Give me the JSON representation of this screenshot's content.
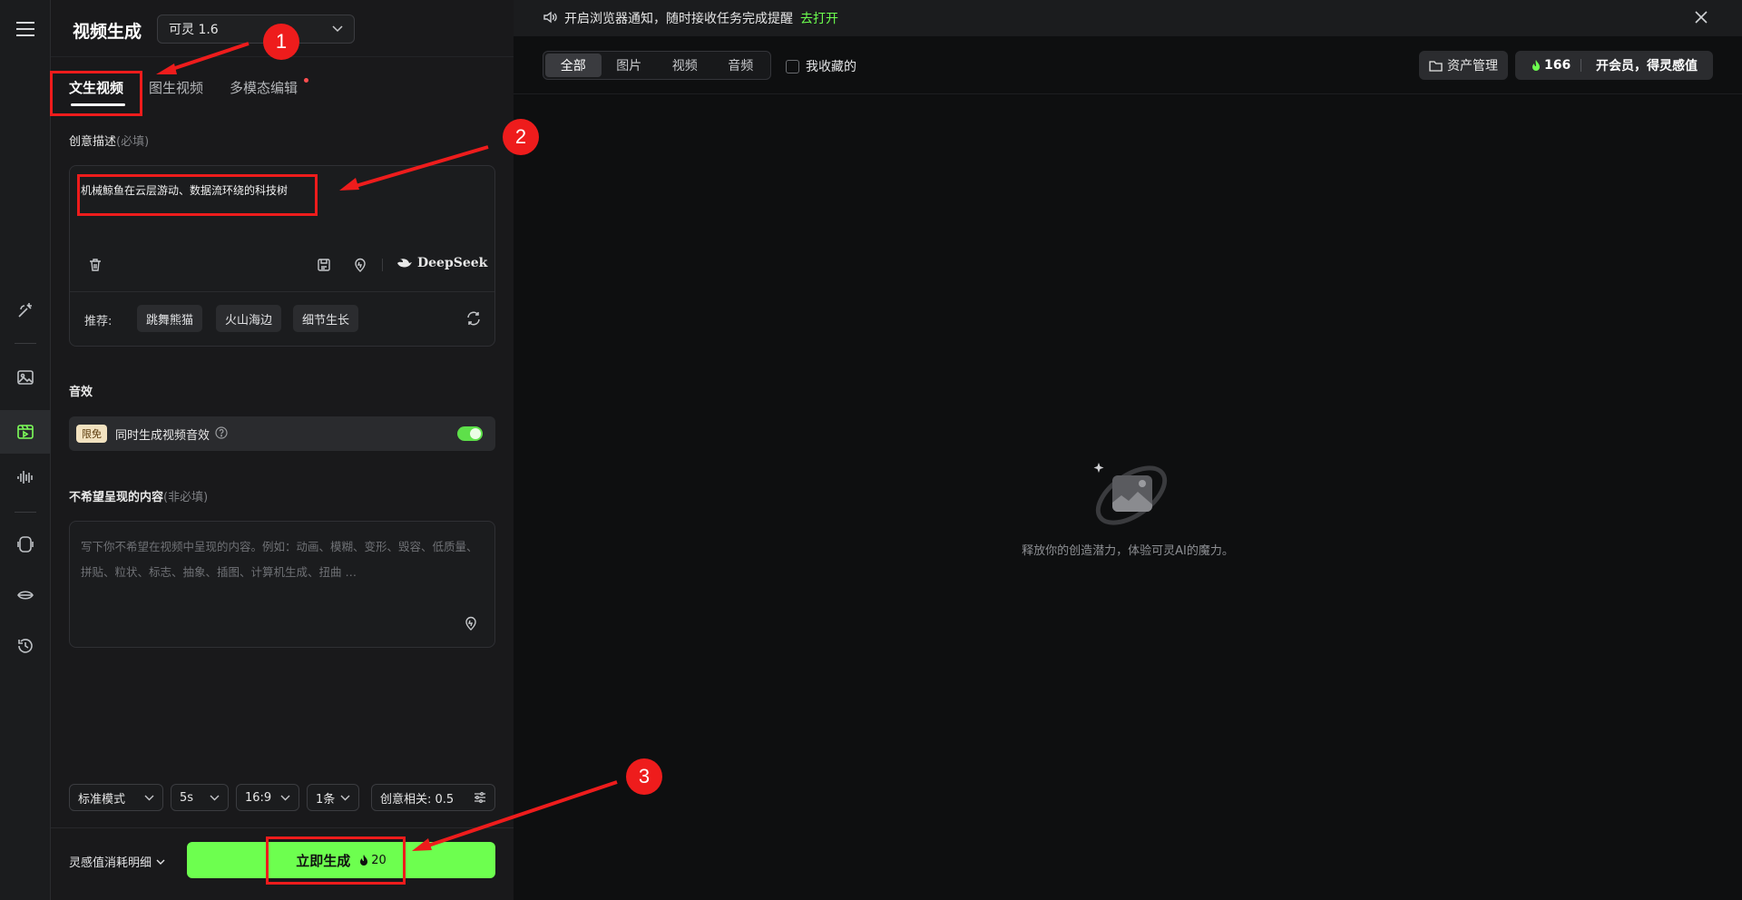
{
  "rail": {
    "icons": [
      "menu-icon",
      "magic-brush-icon",
      "image-icon",
      "video-icon",
      "audio-wave-icon",
      "avatar-icon",
      "lip-sync-icon",
      "history-icon"
    ]
  },
  "panel": {
    "title": "视频生成",
    "model": "可灵 1.6",
    "tabs": [
      {
        "label": "文生视频",
        "active": true
      },
      {
        "label": "图生视频",
        "active": false
      },
      {
        "label": "多模态编辑",
        "active": false,
        "badge_dot": true
      }
    ],
    "prompt": {
      "label": "创意描述",
      "hint": "(必填)",
      "value": "机械鲸鱼在云层游动、数据流环绕的科技树",
      "deepseek_label": "DeepSeek",
      "recommend_label": "推荐:",
      "recommend_chips": [
        "跳舞熊猫",
        "火山海边",
        "细节生长"
      ]
    },
    "sound": {
      "label": "音效",
      "badge": "限免",
      "text": "同时生成视频音效",
      "enabled": true
    },
    "negative": {
      "label": "不希望呈现的内容",
      "hint": "(非必填)",
      "placeholder": "写下你不希望在视频中呈现的内容。例如：动画、模糊、变形、毁容、低质量、拼贴、粒状、标志、抽象、插图、计算机生成、扭曲 …"
    },
    "options": {
      "mode": "标准模式",
      "duration": "5s",
      "ratio": "16:9",
      "count": "1条",
      "creativity": "创意相关: 0.5"
    },
    "cost_detail": "灵感值消耗明细",
    "generate_label": "立即生成",
    "generate_cost": "20"
  },
  "main": {
    "notice_text": "开启浏览器通知，随时接收任务完成提醒",
    "notice_link": "去打开",
    "filters": [
      {
        "label": "全部",
        "active": true
      },
      {
        "label": "图片",
        "active": false
      },
      {
        "label": "视频",
        "active": false
      },
      {
        "label": "音频",
        "active": false
      }
    ],
    "favorites_label": "我收藏的",
    "asset_label": "资产管理",
    "credits": "166",
    "vip_label": "开会员，得灵感值",
    "empty_text": "释放你的创造潜力，体验可灵AI的魔力。"
  },
  "annotations": [
    "1",
    "2",
    "3"
  ],
  "colors": {
    "accent": "#6dff4f",
    "annotation": "#ee1c1c",
    "panel_bg": "#19191b",
    "main_bg": "#0e0f10"
  }
}
